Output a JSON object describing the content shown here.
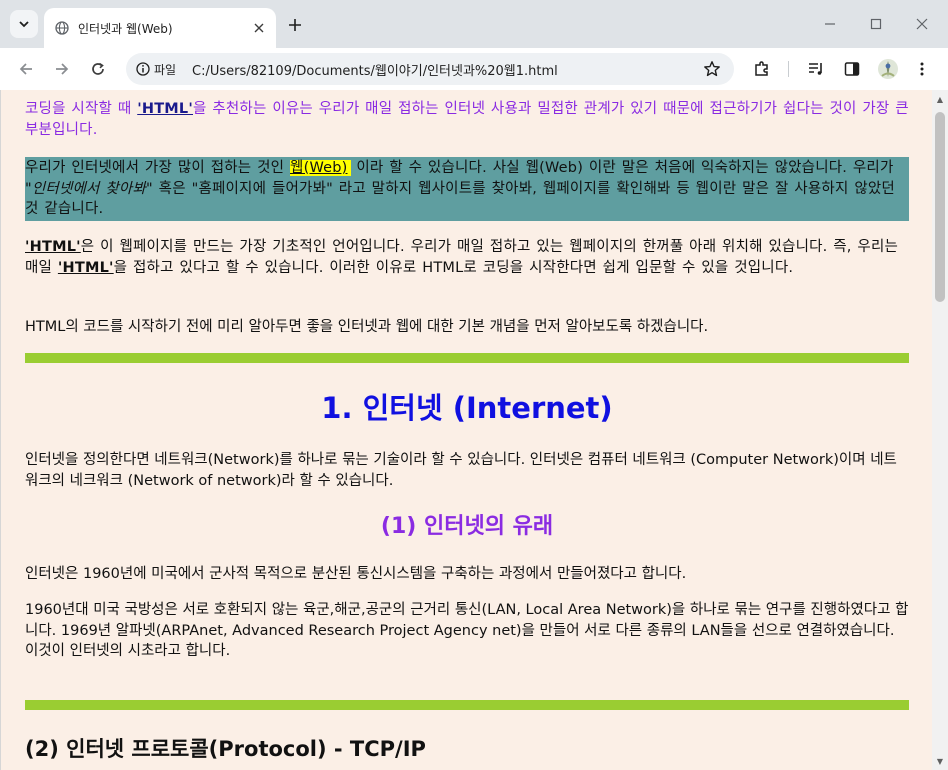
{
  "browser": {
    "tab_title": "인터넷과 웹(Web)",
    "site_chip_label": "파일",
    "url": "C:/Users/82109/Documents/웹이야기/인터넷과%20웹1.html"
  },
  "page": {
    "intro": {
      "before": "코딩을 시작할 때 ",
      "strong": "'HTML'",
      "after": "을 추천하는 이유는 우리가 매일 접하는 인터넷 사용과 밀접한 관계가 있기 때문에 접근하기가 쉽다는 것이 가장 큰 부분입니다."
    },
    "web_block": {
      "before": "우리가 인터넷에서 가장 많이 접하는 것인 ",
      "highlight": "웹(Web)",
      "middle": " 이라 할 수 있습니다. 사실 웹(Web) 이란 말은 처음에 익숙하지는 않았습니다. 우리가 ",
      "italic": "\"인터넷에서 찾아봐\"",
      "after": " 혹은 \"홈페이지에 들어가봐\" 라고 말하지 웹사이트를 찾아봐, 웹페이지를 확인해봐 등 웹이란 말은 잘 사용하지 않았던 것 같습니다."
    },
    "html_para": {
      "strong1": "'HTML'",
      "text1": "은 이 웹페이지를 만드는 가장 기초적인 언어입니다. 우리가 매일 접하고 있는 웹페이지의 한꺼풀 아래 위치해 있습니다. 즉, 우리는 매일 ",
      "strong2": "'HTML'",
      "text2": "을 접하고 있다고 할 수 있습니다. 이러한 이유로 HTML로 코딩을 시작한다면 쉽게 입문할 수 있을 것입니다."
    },
    "basic_para": "HTML의 코드를 시작하기 전에 미리 알아두면 좋을 인터넷과 웹에 대한 기본 개념을 먼저 알아보도록 하겠습니다.",
    "h1": "1. 인터넷 (Internet)",
    "internet_para": "인터넷을 정의한다면 네트워크(Network)를 하나로 묶는 기술이라 할 수 있습니다. 인터넷은 컴퓨터 네트워크 (Computer Network)이며 네트워크의 네크워크 (Network of network)라 할 수 있습니다.",
    "h2": "(1) 인터넷의 유래",
    "origin_para1": "인터넷은 1960년에 미국에서 군사적 목적으로 분산된 통신시스템을 구축하는 과정에서 만들어졌다고 합니다.",
    "origin_para2_line": "1960년대 미국 국방성은 서로 호환되지 않는 육군,해군,공군의 근거리 통신(LAN, Local Area Network)을 하나로 묶는 연구를 진행하였다고 합니다. 1969년 알파넷(ARPAnet, Advanced Research Project Agency net)을 만들어 서로 다른 종류의 LAN들을 선으로 연결하였습니다.",
    "origin_para2_tail": "이것이 인터넷의 시초라고 합니다.",
    "h3": "(2) 인터넷 프로토콜(Protocol) - TCP/IP"
  },
  "colors": {
    "page_bg": "#fbefe6",
    "intro_text": "#8a2be2",
    "teal_bg": "#5f9ea0",
    "highlight": "#ffff00",
    "rule": "#9acd32",
    "h1": "#1010e0",
    "h2": "#8a2be2"
  },
  "icons": [
    "tab-search-icon",
    "globe-icon",
    "close-icon",
    "plus-icon",
    "minimize-icon",
    "maximize-icon",
    "window-close-icon",
    "back-icon",
    "forward-icon",
    "reload-icon",
    "info-icon",
    "star-icon",
    "extensions-icon",
    "media-icon",
    "sidepanel-icon",
    "avatar",
    "menu-icon"
  ]
}
